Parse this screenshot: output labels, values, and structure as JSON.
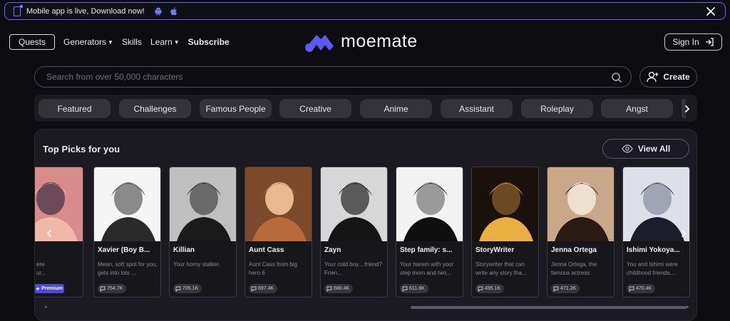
{
  "banner": {
    "text": "Mobile app is live, Download now!",
    "icons": [
      "phone-download-icon",
      "android-icon",
      "apple-icon",
      "close-icon"
    ]
  },
  "nav": {
    "quests": "Quests",
    "generators": "Generators",
    "skills": "Skills",
    "learn": "Learn",
    "subscribe": "Subscribe"
  },
  "logo": {
    "wordmark": "moemate"
  },
  "header": {
    "signin": "Sign In"
  },
  "search": {
    "placeholder": "Search from over 50,000 characters"
  },
  "create": {
    "label": "Create"
  },
  "tabs": [
    "Featured",
    "Challenges",
    "Famous People",
    "Creative",
    "Anime",
    "Assistant",
    "Roleplay",
    "Angst"
  ],
  "section": {
    "title": "Top Picks for you",
    "view_all": "View All"
  },
  "cards": [
    {
      "name": "",
      "desc": "ere\nur...",
      "count": "",
      "premium": "Premium",
      "palette": [
        "#d98b8b",
        "#f1b7a8",
        "#6d4a5a"
      ]
    },
    {
      "name": "Xavier (Boy B...",
      "desc": "Mean, soft spot for you, gets into lots ...",
      "count": "754.7K",
      "palette": [
        "#f5f5f5",
        "#2a2a2a",
        "#8a8a8a"
      ]
    },
    {
      "name": "Killian",
      "desc": "Your horny stalker.",
      "count": "705.1K",
      "palette": [
        "#bfbfbf",
        "#1a1a1a",
        "#6a6a6a"
      ]
    },
    {
      "name": "Aunt Cass",
      "desc": "Aunt Cass from big hero 6",
      "count": "697.4K",
      "palette": [
        "#7a4a2a",
        "#b86a3a",
        "#e9b890"
      ]
    },
    {
      "name": "Zayn",
      "desc": "Your cold boy....friend? Frien...",
      "count": "680.4K",
      "palette": [
        "#d7d7d7",
        "#151515",
        "#5a5a5a"
      ]
    },
    {
      "name": "Step family: s...",
      "desc": "Your harem with your step mom and two...",
      "count": "611.8K",
      "palette": [
        "#f2f2f2",
        "#0f0f0f",
        "#9a9a9a"
      ]
    },
    {
      "name": "StoryWriter",
      "desc": "Storywriter that can write any story tha...",
      "count": "495.1K",
      "palette": [
        "#1a120a",
        "#e8b040",
        "#6a4a20"
      ]
    },
    {
      "name": "Jenna Ortega",
      "desc": "Jenna Ortega, the famous actress",
      "count": "471.2K",
      "palette": [
        "#c9a88a",
        "#2a1a14",
        "#f0e0d0"
      ]
    },
    {
      "name": "Ishimi Yokoya...",
      "desc": "You and Ishimi were childhood friends,...",
      "count": "470.4K",
      "palette": [
        "#dde0e8",
        "#1c1c2a",
        "#a0a4b4"
      ]
    }
  ]
}
